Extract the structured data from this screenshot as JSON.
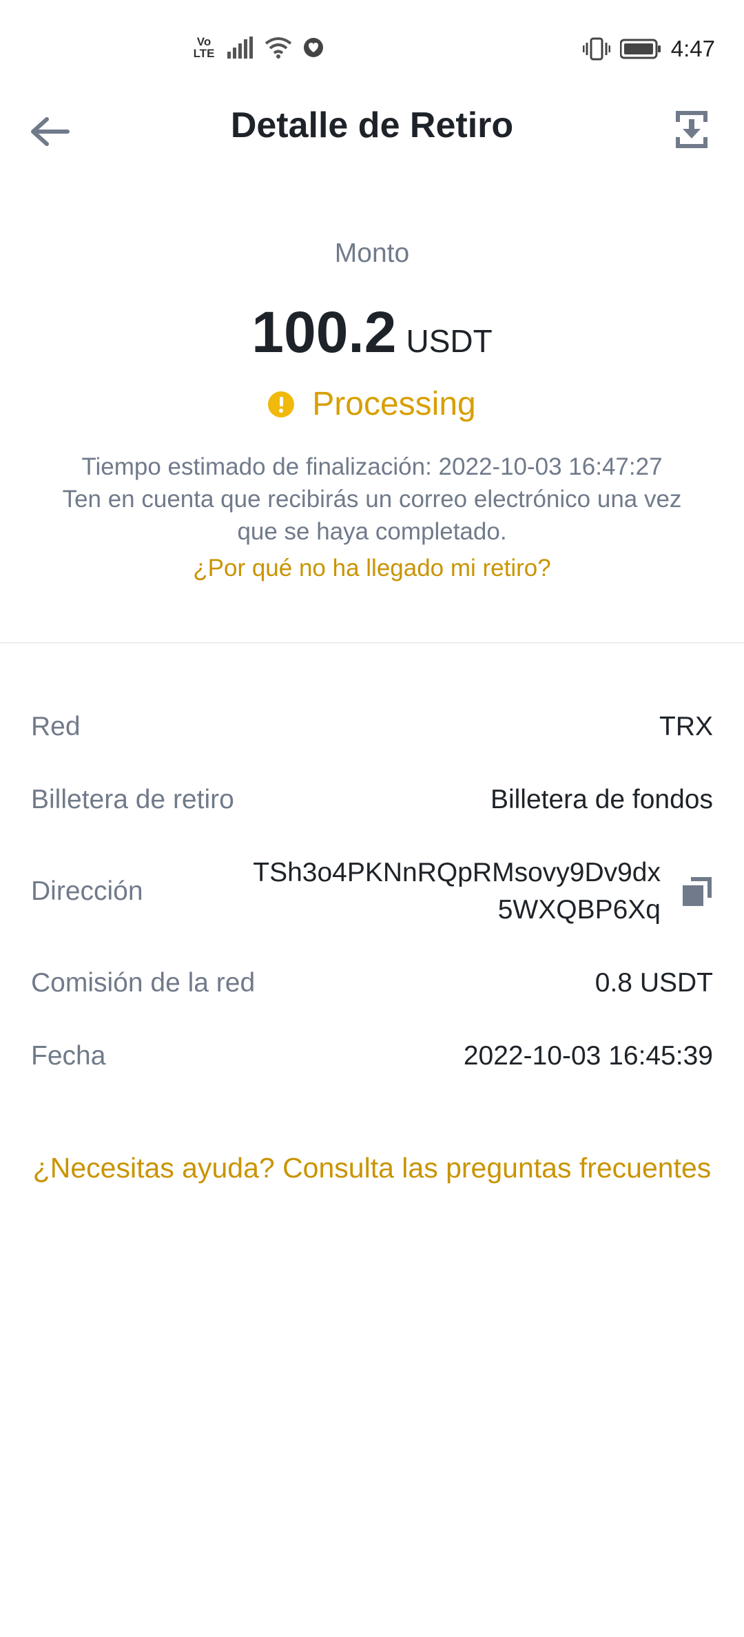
{
  "status_bar": {
    "volte_top": "Vo",
    "volte_bottom": "LTE",
    "time": "4:47"
  },
  "header": {
    "title": "Detalle de Retiro",
    "back_icon": "arrow-left-icon",
    "download_icon": "download-icon"
  },
  "summary": {
    "amount_label": "Monto",
    "amount_value": "100.2",
    "amount_unit": "USDT",
    "status": "Processing",
    "status_color": "#d89f00",
    "estimate_line1": "Tiempo estimado de finalización: 2022-10-03 16:47:27",
    "estimate_line2": "Ten en cuenta que recibirás un correo electrónico una vez que se haya completado.",
    "why_link": "¿Por qué no ha llegado mi retiro?"
  },
  "details": {
    "network_label": "Red",
    "network_value": "TRX",
    "wallet_label": "Billetera de retiro",
    "wallet_value": "Billetera de fondos",
    "address_label": "Dirección",
    "address_value": "TSh3o4PKNnRQpRMsovy9Dv9dx5WXQBP6Xq",
    "fee_label": "Comisión de la red",
    "fee_value": "0.8 USDT",
    "date_label": "Fecha",
    "date_value": "2022-10-03 16:45:39"
  },
  "help_link": "¿Necesitas ayuda? Consulta las preguntas frecuentes",
  "colors": {
    "accent": "#c99400",
    "text_primary": "#1e2329",
    "text_secondary": "#707a8a"
  }
}
